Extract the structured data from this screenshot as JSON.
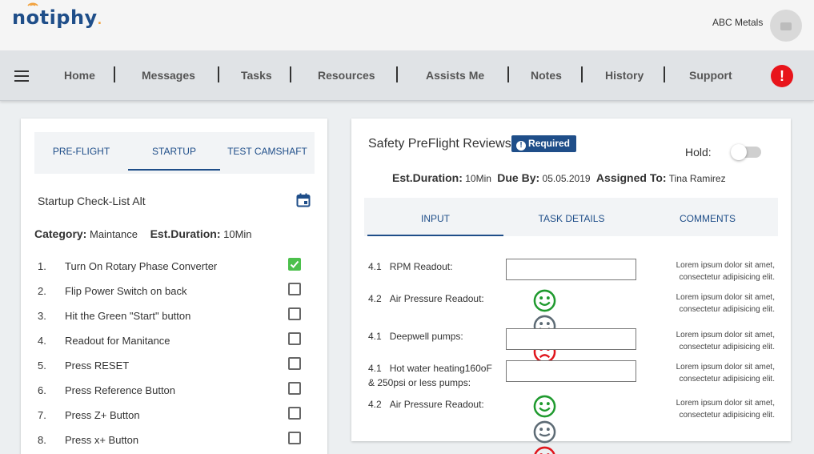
{
  "header": {
    "logo_text_pre": "n",
    "logo_text_o": "o",
    "logo_text_post": "tiphy",
    "logo_dot": ".",
    "company": "ABC Metals"
  },
  "nav": {
    "items": [
      "Home",
      "Messages",
      "Tasks",
      "Resources",
      "Assists Me",
      "Notes",
      "History",
      "Support"
    ],
    "alert_symbol": "!"
  },
  "left": {
    "tabs": [
      "PRE-FLIGHT",
      "STARTUP",
      "TEST CAMSHAFT"
    ],
    "active_tab": "STARTUP",
    "checklist_title": "Startup Check-List Alt",
    "category_label": "Category:",
    "category_value": "Maintance",
    "duration_label": "Est.Duration:",
    "duration_value": "10Min",
    "steps": [
      {
        "num": "1.",
        "text": "Turn On Rotary Phase Converter",
        "checked": true
      },
      {
        "num": "2.",
        "text": "Flip Power Switch on back",
        "checked": false
      },
      {
        "num": "3.",
        "text": "Hit the Green \"Start\" button",
        "checked": false
      },
      {
        "num": "4.",
        "text": "Readout for Manitance",
        "checked": false
      },
      {
        "num": "5.",
        "text": "Press RESET",
        "checked": false
      },
      {
        "num": "6.",
        "text": "Press Reference Button",
        "checked": false
      },
      {
        "num": "7.",
        "text": "Press Z+ Button",
        "checked": false
      },
      {
        "num": "8.",
        "text": "Press x+ Button",
        "checked": false
      }
    ]
  },
  "right": {
    "title": "Safety PreFlight Reviews",
    "required_badge": "Required",
    "required_symbol": "!",
    "hold_label": "Hold:",
    "hold_on": false,
    "meta": {
      "duration_label": "Est.Duration:",
      "duration_value": "10Min",
      "due_label": "Due By:",
      "due_value": "05.05.2019",
      "assigned_label": "Assigned To:",
      "assigned_value": "Tina Ramirez"
    },
    "tabs": [
      "INPUT",
      "TASK DETAILS",
      "COMMENTS"
    ],
    "active_tab": "INPUT",
    "rows": [
      {
        "num": "4.1",
        "label": "RPM Readout:",
        "kind": "input",
        "value": "",
        "note_line1": "Lorem ipsum dolor sit amet,",
        "note_line2": "consectetur adipisicing elit."
      },
      {
        "num": "4.2",
        "label": "Air Pressure Readout:",
        "kind": "faces",
        "note_line1": "Lorem ipsum dolor sit amet,",
        "note_line2": "consectetur adipisicing elit."
      },
      {
        "num": "4.1",
        "label": "Deepwell pumps:",
        "kind": "input",
        "value": "",
        "note_line1": "Lorem ipsum dolor sit amet,",
        "note_line2": "consectetur adipisicing elit."
      },
      {
        "num": "4.1",
        "label": "Hot water heating160oF",
        "label2": "& 250psi or less pumps:",
        "kind": "input",
        "value": "",
        "note_line1": "Lorem ipsum dolor sit amet,",
        "note_line2": "consectetur adipisicing elit."
      },
      {
        "num": "4.2",
        "label": "Air Pressure Readout:",
        "kind": "faces",
        "note_line1": "Lorem ipsum dolor sit amet,",
        "note_line2": "consectetur adipisicing elit."
      }
    ],
    "faces": [
      "happy-face",
      "neutral-face",
      "sad-face"
    ]
  },
  "colors": {
    "brand": "#1f4e89",
    "alert": "#e8141b",
    "check": "#4cc04c",
    "happy": "#1f9a2e",
    "neutral": "#5d6b75",
    "sad": "#e0151c"
  }
}
